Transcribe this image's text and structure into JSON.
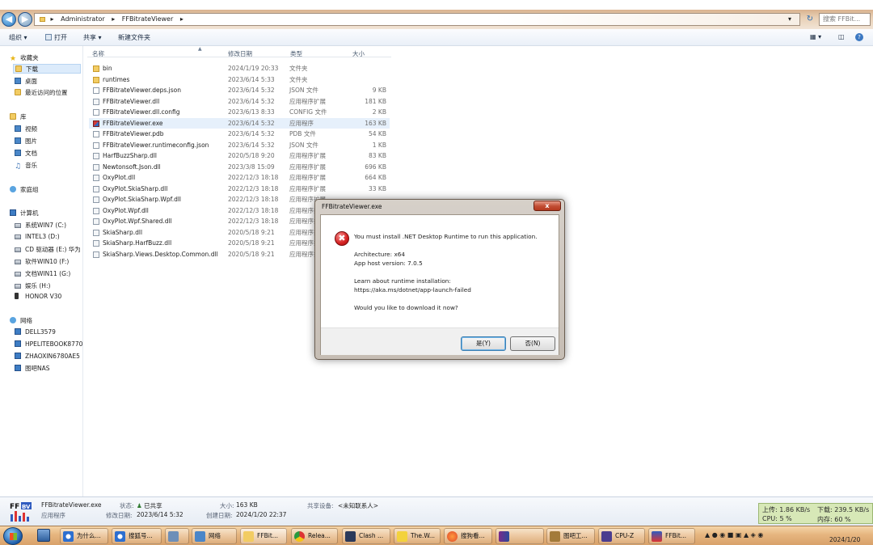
{
  "explorer": {
    "breadcrumb": [
      "Administrator",
      "FFBitrateViewer"
    ],
    "search_placeholder": "搜索 FFBit...",
    "toolbar": {
      "organize": "组织",
      "open": "打开",
      "share": "共享",
      "new_folder": "新建文件夹"
    },
    "nav": {
      "favorites_label": "收藏夹",
      "favorites": [
        "下载",
        "桌面",
        "最近访问的位置"
      ],
      "libraries_label": "库",
      "libraries": [
        "视频",
        "图片",
        "文档",
        "音乐"
      ],
      "homegroup": "家庭组",
      "computer_label": "计算机",
      "drives": [
        "系统WIN7 (C:)",
        "INTEL3 (D:)",
        "CD 驱动器 (E:) 华为",
        "软件WIN10 (F:)",
        "文档WIN11 (G:)",
        "娱乐 (H:)",
        "HONOR V30"
      ],
      "network_label": "网络",
      "network": [
        "DELL3579",
        "HPELITEBOOK8770",
        "ZHAOXIN6780AE5",
        "图吧NAS"
      ]
    },
    "columns": {
      "name": "名称",
      "date": "修改日期",
      "type": "类型",
      "size": "大小"
    },
    "files": [
      {
        "name": "bin",
        "date": "2024/1/19 20:33",
        "type": "文件夹",
        "size": "",
        "icon": "folder"
      },
      {
        "name": "runtimes",
        "date": "2023/6/14 5:33",
        "type": "文件夹",
        "size": "",
        "icon": "folder"
      },
      {
        "name": "FFBitrateViewer.deps.json",
        "date": "2023/6/14 5:32",
        "type": "JSON 文件",
        "size": "9 KB",
        "icon": "doc"
      },
      {
        "name": "FFBitrateViewer.dll",
        "date": "2023/6/14 5:32",
        "type": "应用程序扩展",
        "size": "181 KB",
        "icon": "dll"
      },
      {
        "name": "FFBitrateViewer.dll.config",
        "date": "2023/6/13 8:33",
        "type": "CONFIG 文件",
        "size": "2 KB",
        "icon": "doc"
      },
      {
        "name": "FFBitrateViewer.exe",
        "date": "2023/6/14 5:32",
        "type": "应用程序",
        "size": "163 KB",
        "icon": "exe"
      },
      {
        "name": "FFBitrateViewer.pdb",
        "date": "2023/6/14 5:32",
        "type": "PDB 文件",
        "size": "54 KB",
        "icon": "doc"
      },
      {
        "name": "FFBitrateViewer.runtimeconfig.json",
        "date": "2023/6/14 5:32",
        "type": "JSON 文件",
        "size": "1 KB",
        "icon": "doc"
      },
      {
        "name": "HarfBuzzSharp.dll",
        "date": "2020/5/18 9:20",
        "type": "应用程序扩展",
        "size": "83 KB",
        "icon": "dll"
      },
      {
        "name": "Newtonsoft.Json.dll",
        "date": "2023/3/8 15:09",
        "type": "应用程序扩展",
        "size": "696 KB",
        "icon": "dll"
      },
      {
        "name": "OxyPlot.dll",
        "date": "2022/12/3 18:18",
        "type": "应用程序扩展",
        "size": "664 KB",
        "icon": "dll"
      },
      {
        "name": "OxyPlot.SkiaSharp.dll",
        "date": "2022/12/3 18:18",
        "type": "应用程序扩展",
        "size": "33 KB",
        "icon": "dll"
      },
      {
        "name": "OxyPlot.SkiaSharp.Wpf.dll",
        "date": "2022/12/3 18:18",
        "type": "应用程序扩展",
        "size": "",
        "icon": "dll"
      },
      {
        "name": "OxyPlot.Wpf.dll",
        "date": "2022/12/3 18:18",
        "type": "应用程序扩展",
        "size": "",
        "icon": "dll"
      },
      {
        "name": "OxyPlot.Wpf.Shared.dll",
        "date": "2022/12/3 18:18",
        "type": "应用程序扩展",
        "size": "",
        "icon": "dll"
      },
      {
        "name": "SkiaSharp.dll",
        "date": "2020/5/18 9:21",
        "type": "应用程序扩展",
        "size": "",
        "icon": "dll"
      },
      {
        "name": "SkiaSharp.HarfBuzz.dll",
        "date": "2020/5/18 9:21",
        "type": "应用程序扩展",
        "size": "",
        "icon": "dll"
      },
      {
        "name": "SkiaSharp.Views.Desktop.Common.dll",
        "date": "2020/5/18 9:21",
        "type": "应用程序扩展",
        "size": "",
        "icon": "dll"
      }
    ],
    "details": {
      "filename": "FFBitrateViewer.exe",
      "filetype": "应用程序",
      "state_label": "状态:",
      "state_value": "已共享",
      "modified_label": "修改日期:",
      "modified_value": "2023/6/14 5:32",
      "size_label": "大小:",
      "size_value": "163 KB",
      "created_label": "创建日期:",
      "created_value": "2024/1/20 22:37",
      "shared_label": "共享设备:",
      "shared_value": "<未知联系人>"
    }
  },
  "dialog": {
    "title": "FFBitrateViewer.exe",
    "close": "x",
    "line1": "You must install .NET Desktop Runtime to run this application.",
    "arch": "Architecture: x64",
    "version": "App host version: 7.0.5",
    "learn": "Learn about runtime installation:",
    "link": "https://aka.ms/dotnet/app-launch-failed",
    "question": "Would you like to download it now?",
    "yes": "是(Y)",
    "no": "否(N)"
  },
  "netmeter": {
    "up": "上传: 1.86 KB/s",
    "down": "下载: 239.5 KB/s",
    "cpu": "CPU: 5 %",
    "mem": "内存: 60 %"
  },
  "taskbar": {
    "items": [
      "为什么...",
      "搜狐号...",
      "",
      "网络",
      "FFBit...",
      "Relea...",
      "Clash ...",
      "The.W...",
      "搜狗看...",
      "",
      "图吧工...",
      "CPU-Z",
      "FFBit..."
    ],
    "date": "2024/1/20"
  }
}
